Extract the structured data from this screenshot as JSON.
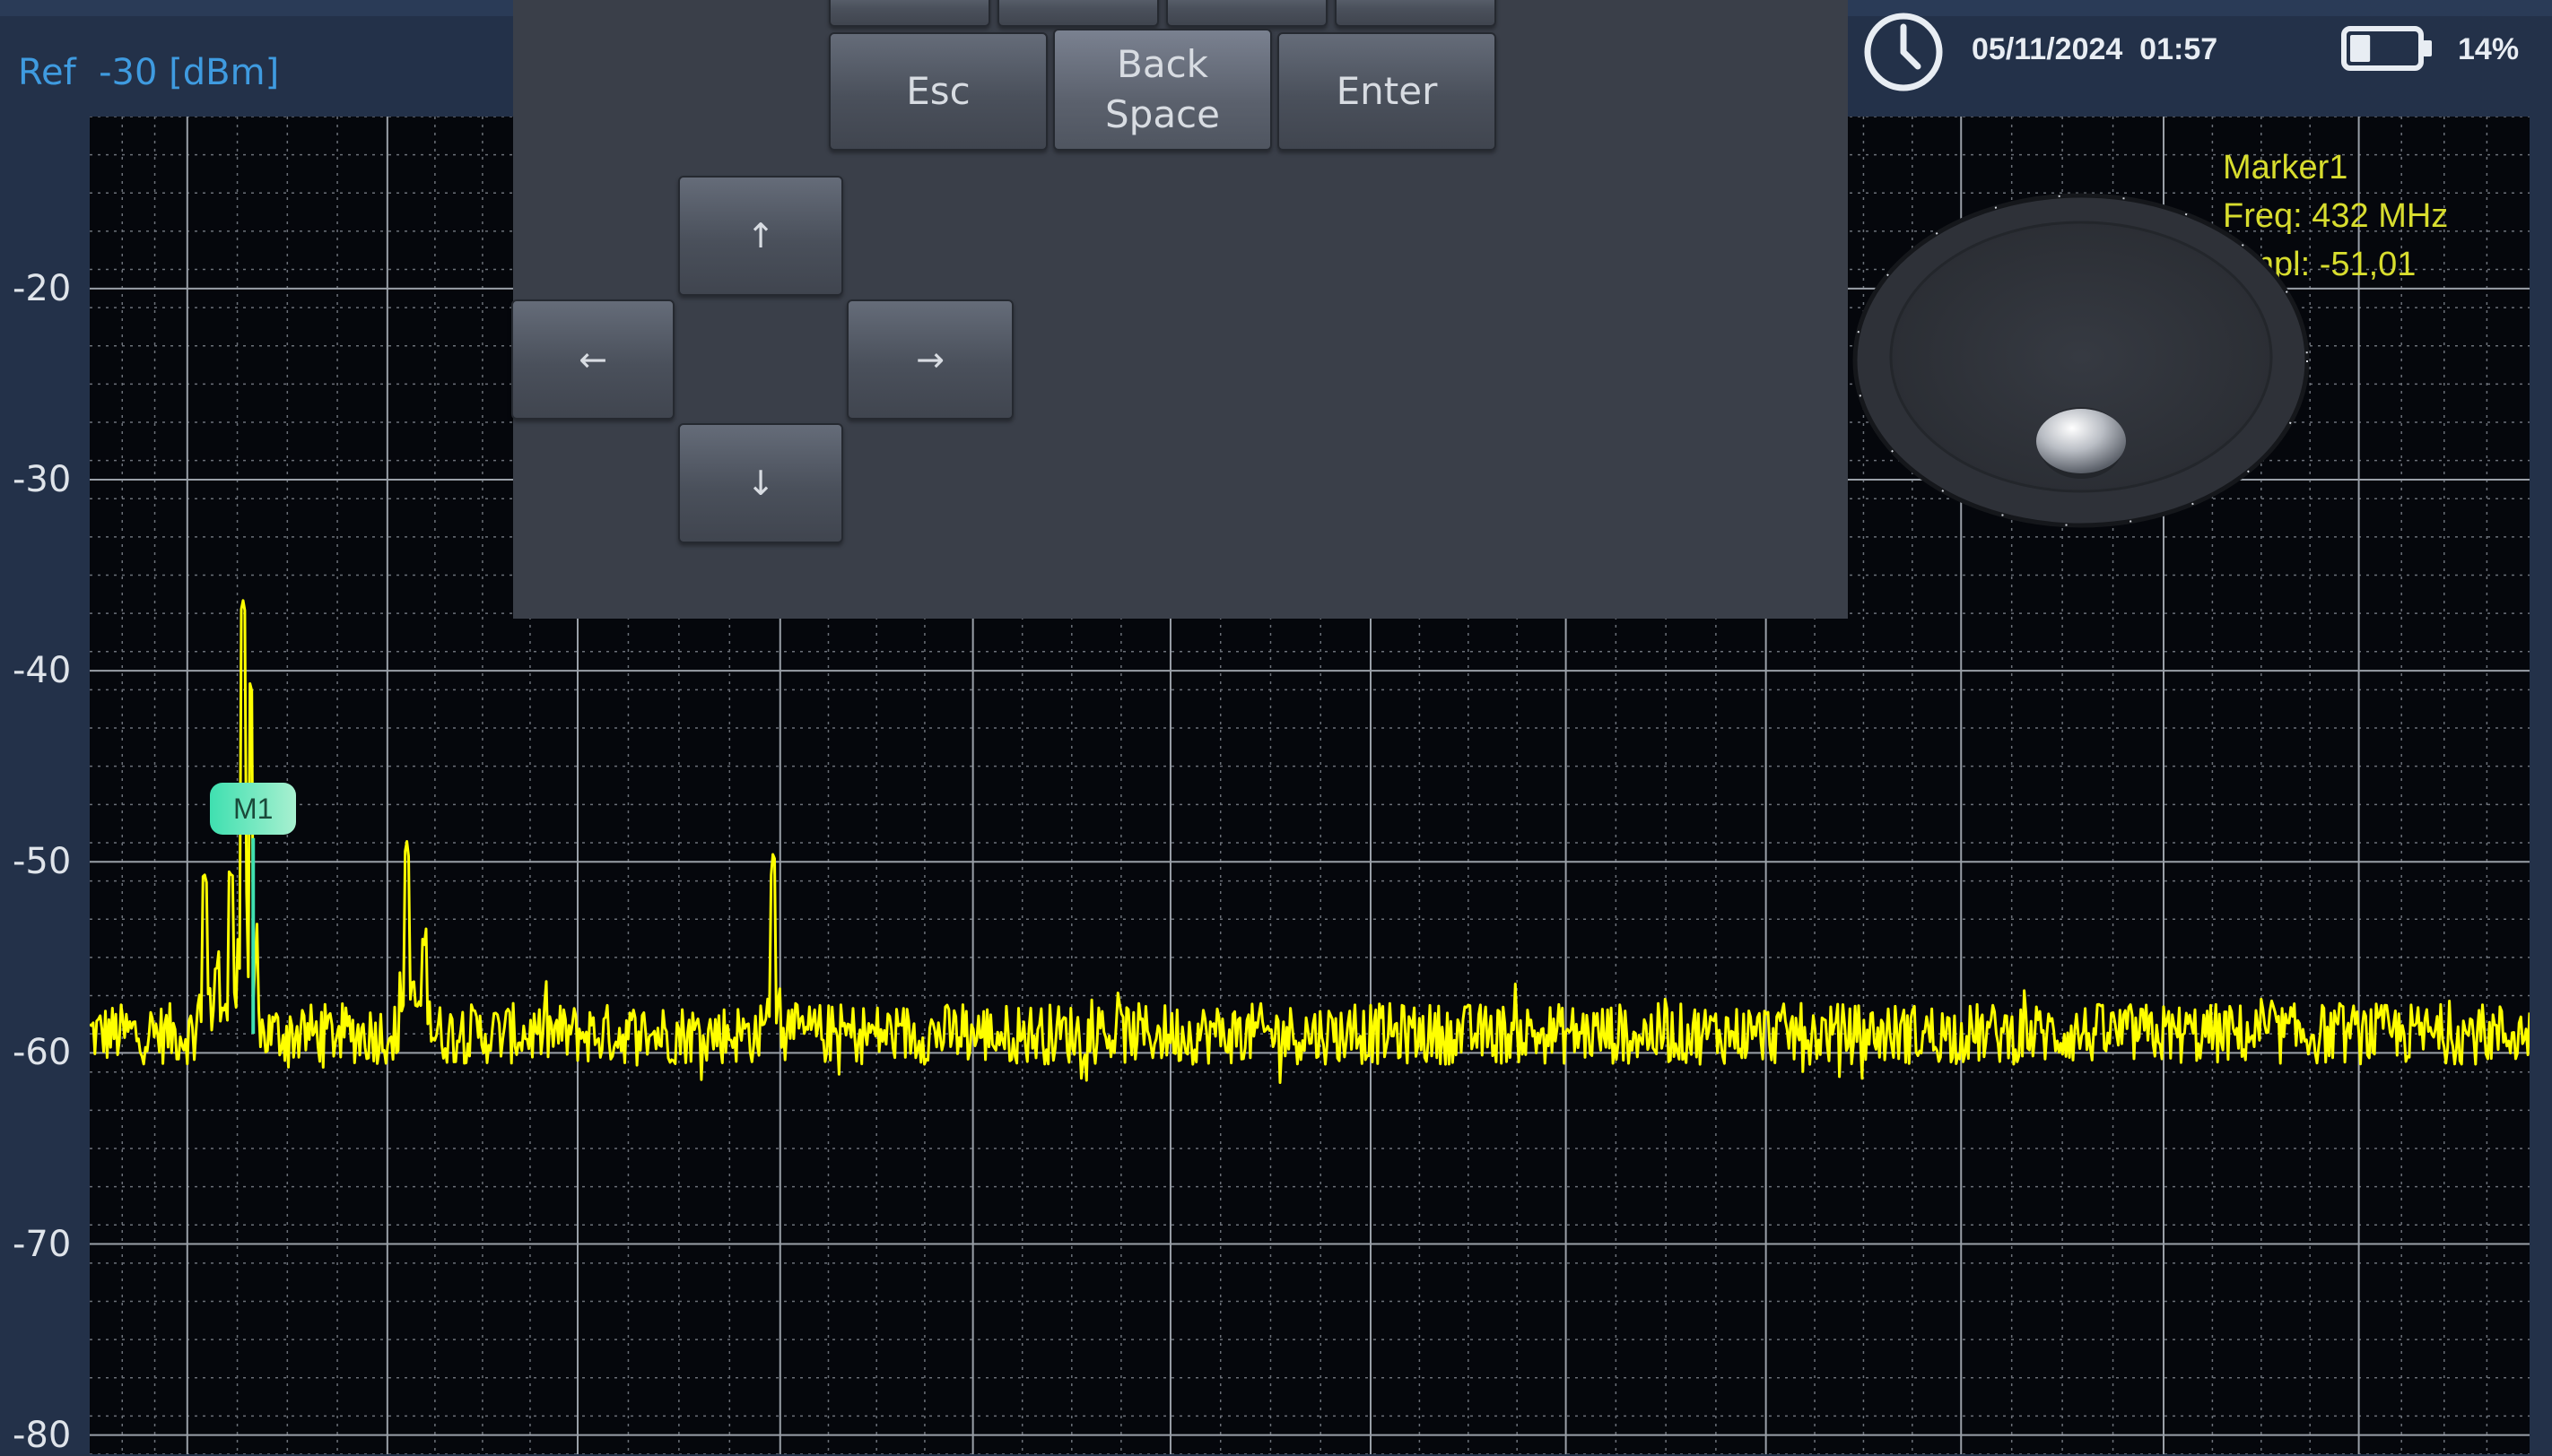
{
  "header": {
    "ref_label": "Ref  -30 [dBm]",
    "date": "05/11/2024  01:57",
    "battery_percent": "14%",
    "battery_level": 0.14,
    "clock_icon": "clock-icon",
    "battery_icon": "battery-icon"
  },
  "keypad": {
    "esc_label": "Esc",
    "backspace_label": "Back\nSpace",
    "enter_label": "Enter",
    "up_label": "↑",
    "left_label": "←",
    "right_label": "→",
    "down_label": "↓",
    "joystick_icon": "joystick-icon"
  },
  "marker": {
    "badge": "M1",
    "title": "Marker1",
    "freq": "Freq: 432 MHz",
    "ampl": "Ampl: -51,01"
  },
  "colors": {
    "background": "#233149",
    "plot_bg": "#05070c",
    "trace": "#ffff00",
    "ref_text": "#3f9be0",
    "marker_text": "#d8dd2e",
    "marker_badge": "#3fe0b0",
    "grid": "#8a9099"
  },
  "chart_data": {
    "type": "line",
    "y_ticks": [
      "-20",
      "-30",
      "-40",
      "-50",
      "-60",
      "-70",
      "-80"
    ],
    "ylim": [
      -81,
      -11
    ],
    "y_unit": "dBm",
    "reference_level": -30,
    "grid": true,
    "noise_floor": -59,
    "x_domain": [
      0,
      1
    ],
    "peaks": [
      {
        "x": 0.047,
        "y": -50.5
      },
      {
        "x": 0.052,
        "y": -55
      },
      {
        "x": 0.058,
        "y": -51
      },
      {
        "x": 0.063,
        "y": -36.5
      },
      {
        "x": 0.066,
        "y": -41
      },
      {
        "x": 0.13,
        "y": -49.5
      },
      {
        "x": 0.137,
        "y": -54
      },
      {
        "x": 0.28,
        "y": -50
      }
    ],
    "marker": {
      "name": "M1",
      "freq_mhz": 432,
      "ampl_dbm": -51.01,
      "x": 0.067
    }
  }
}
